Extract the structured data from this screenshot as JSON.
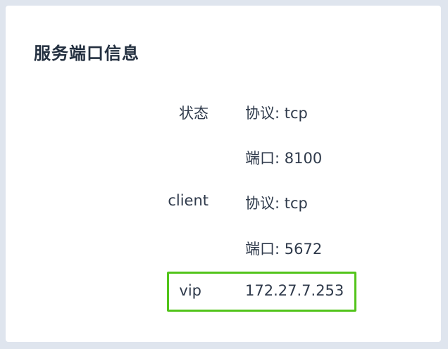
{
  "title": "服务端口信息",
  "rows": [
    {
      "label": "状态",
      "entries": [
        {
          "key": "协议",
          "value": "tcp"
        },
        {
          "key": "端口",
          "value": "8100"
        }
      ]
    },
    {
      "label": "client",
      "entries": [
        {
          "key": "协议",
          "value": "tcp"
        },
        {
          "key": "端口",
          "value": "5672"
        }
      ]
    },
    {
      "label": "vip",
      "value": "172.27.7.253"
    }
  ],
  "colors": {
    "highlight": "#52c41a",
    "text": "#2f3a4b",
    "background": "#dfe5ee"
  }
}
